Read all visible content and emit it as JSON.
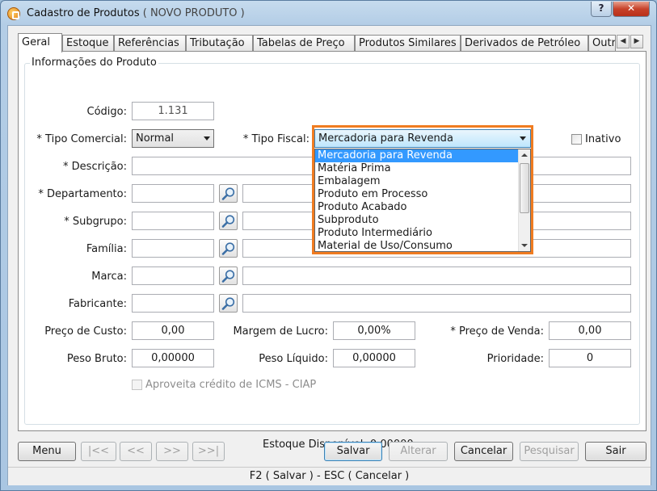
{
  "window": {
    "title": "Cadastro de Produtos",
    "subtitle": "( NOVO PRODUTO )",
    "help_label": "?",
    "close_label": "✕"
  },
  "tabs": [
    {
      "label": "Geral",
      "active": true
    },
    {
      "label": "Estoque"
    },
    {
      "label": "Referências"
    },
    {
      "label": "Tributação"
    },
    {
      "label": "Tabelas de Preço"
    },
    {
      "label": "Produtos Similares"
    },
    {
      "label": "Derivados de Petróleo"
    },
    {
      "label": "Outr"
    }
  ],
  "group_title": "Informações do Produto",
  "form": {
    "codigo_label": "Código:",
    "codigo_value": "1.131",
    "tipo_comercial_label": "* Tipo Comercial:",
    "tipo_comercial_value": "Normal",
    "tipo_fiscal_label": "* Tipo Fiscal:",
    "tipo_fiscal_value": "Mercadoria para Revenda",
    "inativo_label": "Inativo",
    "descricao_label": "* Descrição:",
    "departamento_label": "* Departamento:",
    "subgrupo_label": "* Subgrupo:",
    "familia_label": "Família:",
    "marca_label": "Marca:",
    "fabricante_label": "Fabricante:",
    "preco_custo_label": "Preço de Custo:",
    "preco_custo_value": "0,00",
    "margem_lucro_label": "Margem de Lucro:",
    "margem_lucro_value": "0,00%",
    "preco_venda_label": "* Preço de Venda:",
    "preco_venda_value": "0,00",
    "peso_bruto_label": "Peso Bruto:",
    "peso_bruto_value": "0,00000",
    "peso_liquido_label": "Peso Líquido:",
    "peso_liquido_value": "0,00000",
    "prioridade_label": "Prioridade:",
    "prioridade_value": "0",
    "ciap_label": "Aproveita crédito de ICMS - CIAP",
    "estoque_label": "Estoque Disponível: 0,00000"
  },
  "tipo_fiscal_options": [
    "Mercadoria para Revenda",
    "Matéria Prima",
    "Embalagem",
    "Produto em Processo",
    "Produto Acabado",
    "Subproduto",
    "Produto Intermediário",
    "Material de Uso/Consumo"
  ],
  "buttons": {
    "menu": "Menu",
    "first": "|<<",
    "prev": "<<",
    "next": ">>",
    "last": ">>|",
    "salvar": "Salvar",
    "alterar": "Alterar",
    "cancelar": "Cancelar",
    "pesquisar": "Pesquisar",
    "sair": "Sair"
  },
  "status_bar": "F2 ( Salvar )  -  ESC ( Cancelar )",
  "colors": {
    "highlight": "#f07c21",
    "selection": "#3399ff"
  }
}
